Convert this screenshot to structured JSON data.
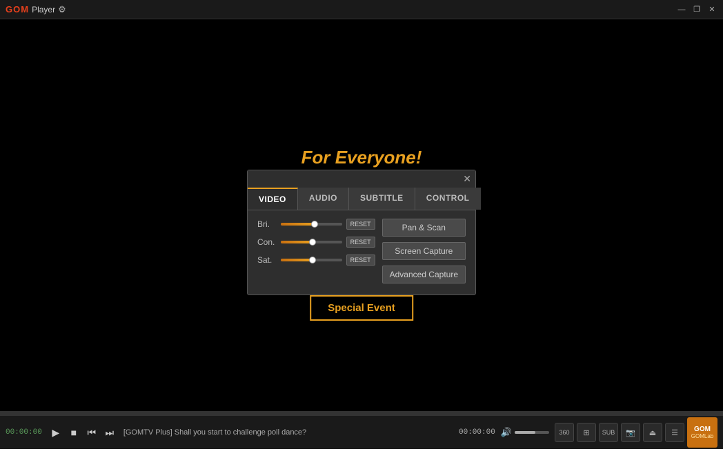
{
  "titlebar": {
    "app_name": "GOM",
    "app_title": "Player",
    "gear_icon": "⚙",
    "minimize_icon": "—",
    "restore_icon": "❐",
    "close_icon": "✕",
    "window_controls": [
      "—",
      "❐",
      "✕"
    ]
  },
  "video_area": {
    "promo_text": "For Everyone!",
    "special_event_label": "Special Event"
  },
  "dialog": {
    "close_icon": "✕",
    "tabs": [
      {
        "id": "video",
        "label": "VIDEO",
        "active": true
      },
      {
        "id": "audio",
        "label": "AUDIO",
        "active": false
      },
      {
        "id": "subtitle",
        "label": "SUBTITLE",
        "active": false
      },
      {
        "id": "control",
        "label": "CONTROL",
        "active": false
      }
    ],
    "sliders": [
      {
        "label": "Bri.",
        "value": 55,
        "reset_label": "RESET"
      },
      {
        "label": "Con.",
        "value": 52,
        "reset_label": "RESET"
      },
      {
        "label": "Sat.",
        "value": 52,
        "reset_label": "RESET"
      }
    ],
    "action_buttons": [
      {
        "label": "Pan & Scan"
      },
      {
        "label": "Screen Capture"
      },
      {
        "label": "Advanced Capture"
      }
    ]
  },
  "bottom_bar": {
    "time_left": "00:00:00",
    "time_right": "00:00:00",
    "song_title": "[GOMTV Plus] Shall you start to challenge poll dance?",
    "play_icon": "▶",
    "stop_icon": "■",
    "prev_icon": "⏮",
    "next_icon": "⏭",
    "volume_icon": "🔊",
    "right_icons": [
      "360",
      "□",
      "SUB",
      "📷",
      "⏏",
      "☰"
    ],
    "gom_logo": "GOM",
    "gom_sub": "GOMLab"
  }
}
